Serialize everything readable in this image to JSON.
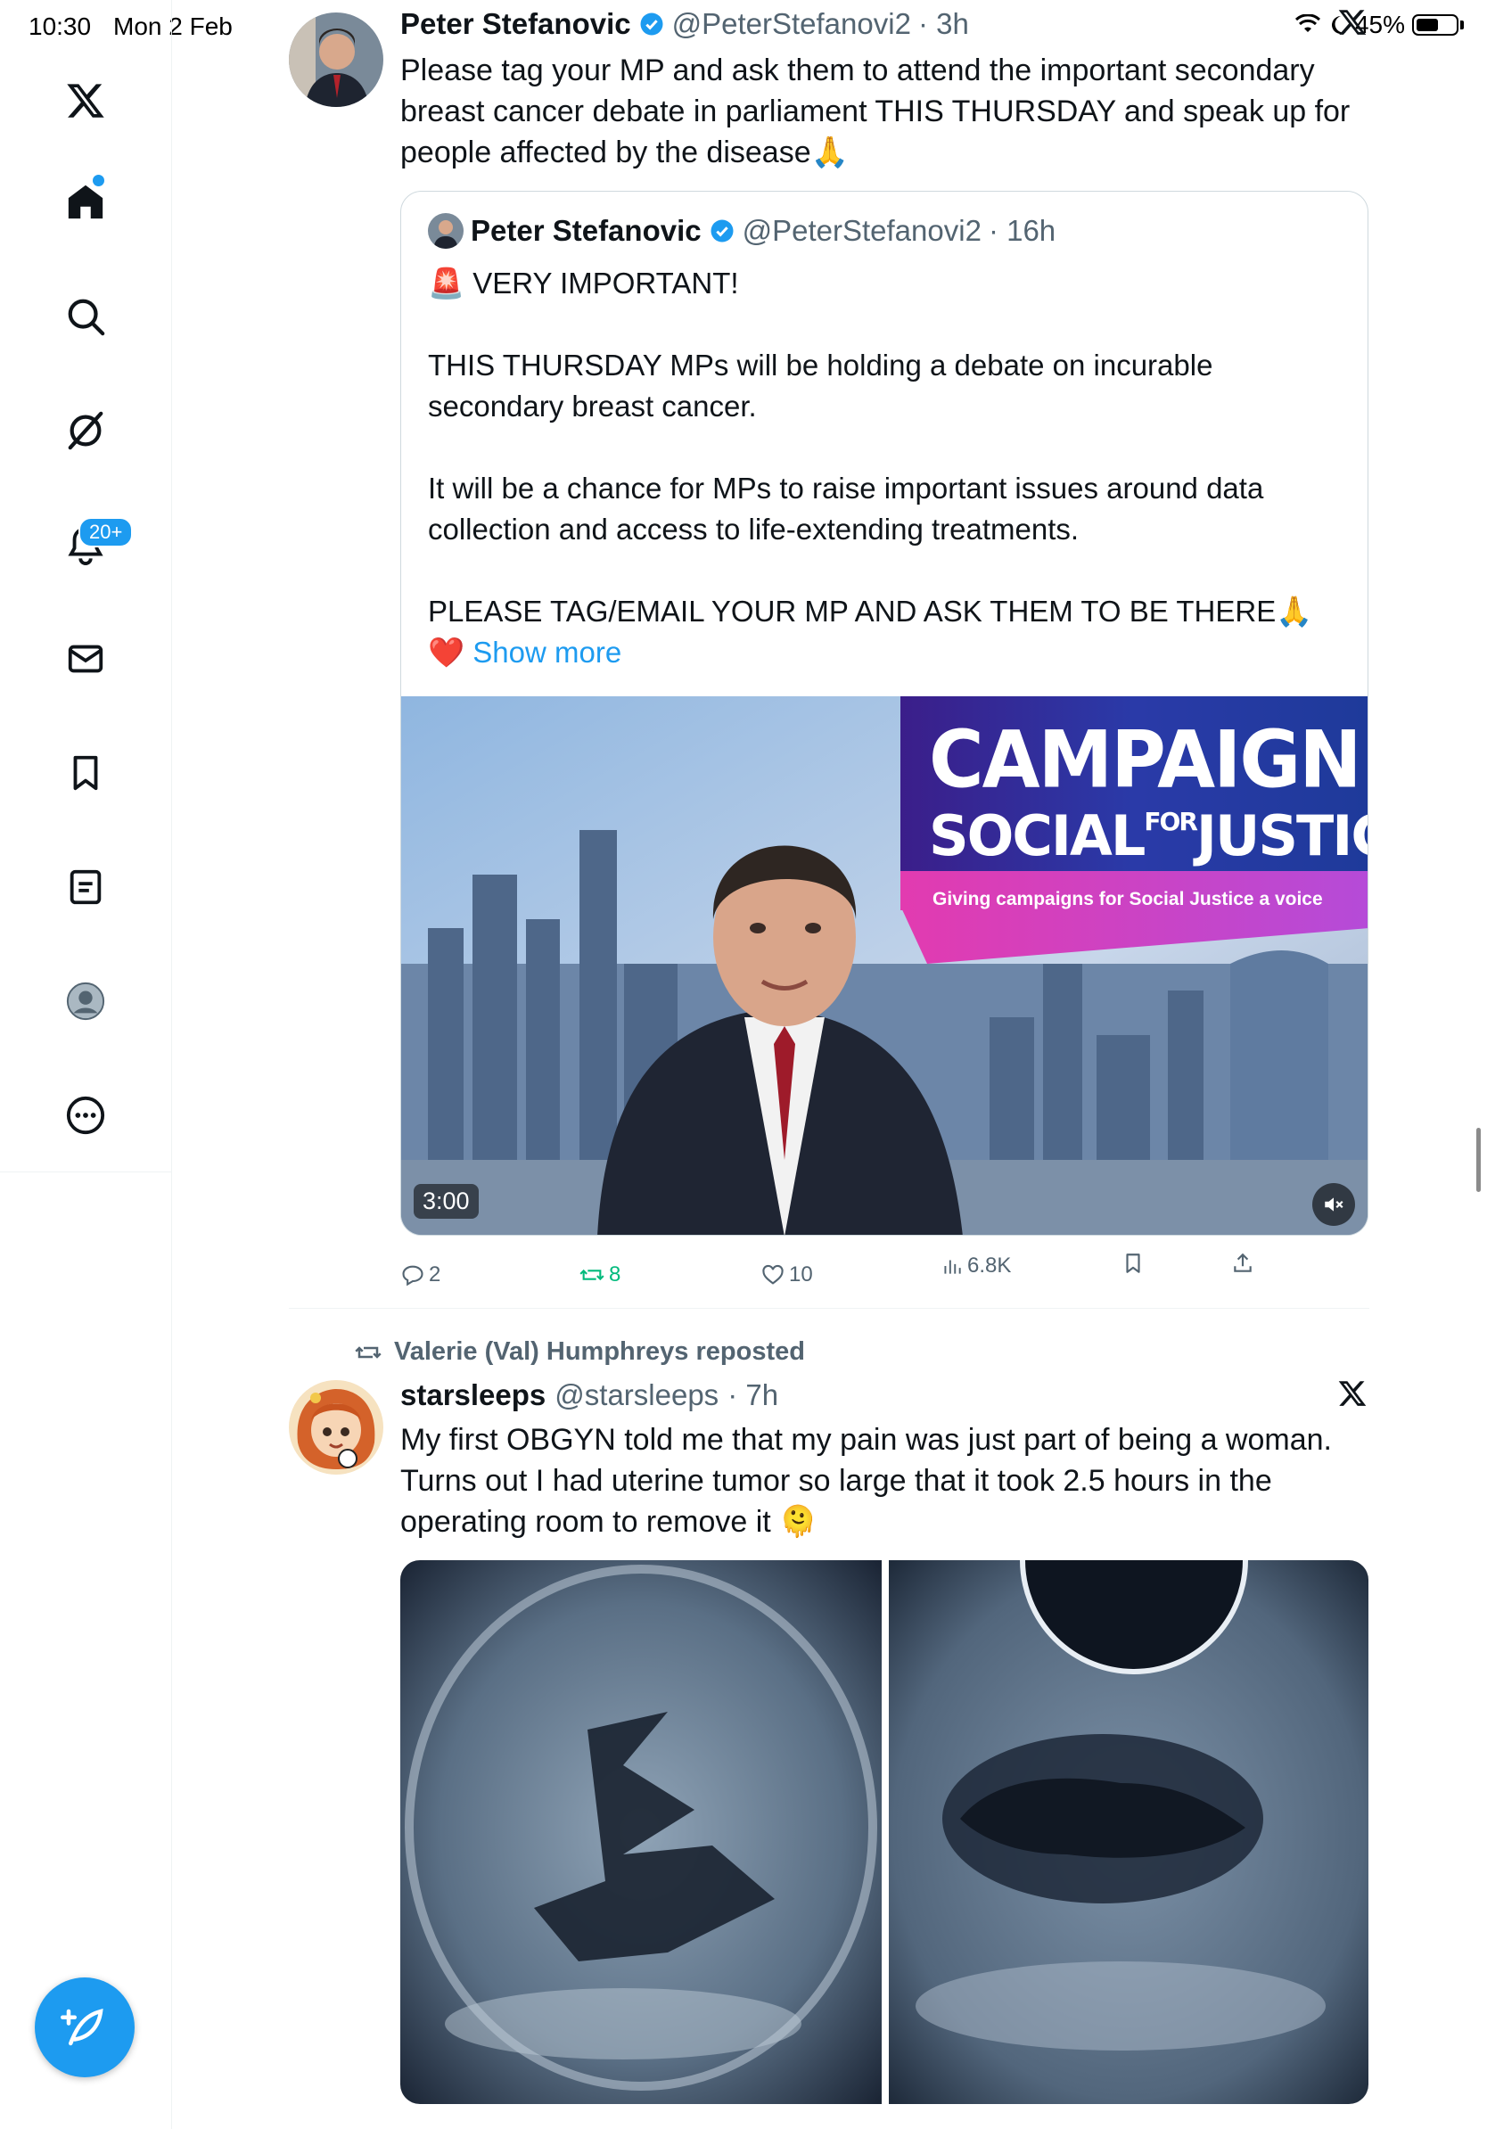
{
  "status_bar": {
    "time": "10:30",
    "date": "Mon 2 Feb",
    "battery": "45%"
  },
  "sidebar": {
    "notifications_badge": "20+",
    "items": [
      "x-logo",
      "home",
      "search",
      "grok",
      "notifications",
      "messages",
      "bookmarks",
      "lists",
      "profile",
      "more"
    ]
  },
  "tweet1": {
    "name": "Peter Stefanovic",
    "handle": "@PeterStefanovi2",
    "time": "· 3h",
    "text": "Please tag your MP and ask them to attend the important secondary breast cancer debate in parliament THIS THURSDAY and speak up for people affected by the disease🙏",
    "quote": {
      "name": "Peter Stefanovic",
      "handle": "@PeterStefanovi2",
      "time": "· 16h",
      "text": "🚨 VERY IMPORTANT!\n\nTHIS THURSDAY MPs will be holding a debate on incurable secondary breast cancer.\n\nIt will be a chance for MPs to raise important issues around data collection and access to life-extending treatments.\n\nPLEASE TAG/EMAIL YOUR MP AND ASK THEM TO BE THERE🙏\n❤️",
      "show_more": "Show more",
      "video": {
        "campaign_line1": "CAMPAIGN",
        "campaign_line2a": "SOCIAL",
        "campaign_line2b": "FOR",
        "campaign_line2c": "JUSTICE",
        "tagline": "Giving campaigns for Social Justice a voice",
        "duration": "3:00"
      }
    },
    "actions": {
      "replies": "2",
      "reposts": "8",
      "likes": "10",
      "views": "6.8K"
    }
  },
  "tweet2": {
    "reposted_by": "Valerie (Val) Humphreys reposted",
    "name": "starsleeps",
    "handle": "@starsleeps",
    "time": "· 7h",
    "text": "My first OBGYN told me that my pain was just part of being a woman. Turns out I had uterine tumor so large that it took 2.5 hours in the operating room to remove it 🫠"
  },
  "colors": {
    "accent": "#1d9bf0",
    "text": "#0f1419",
    "secondary": "#536471",
    "repost_green": "#00ba7c"
  }
}
